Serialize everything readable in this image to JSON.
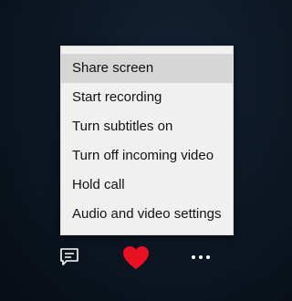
{
  "menu": {
    "items": [
      {
        "label": "Share screen",
        "highlighted": true
      },
      {
        "label": "Start recording",
        "highlighted": false
      },
      {
        "label": "Turn subtitles on",
        "highlighted": false
      },
      {
        "label": "Turn off incoming video",
        "highlighted": false
      },
      {
        "label": "Hold call",
        "highlighted": false
      },
      {
        "label": "Audio and video settings",
        "highlighted": false
      }
    ]
  },
  "controls": {
    "chat_icon": "chat-icon",
    "heart_icon": "heart-icon",
    "more_icon": "more-options-icon",
    "heart_color": "#e81123",
    "icon_color": "#ffffff",
    "menu_bg": "#f0f0f0",
    "highlight_bg": "#d6d6d6",
    "page_bg": "#0c1622"
  }
}
